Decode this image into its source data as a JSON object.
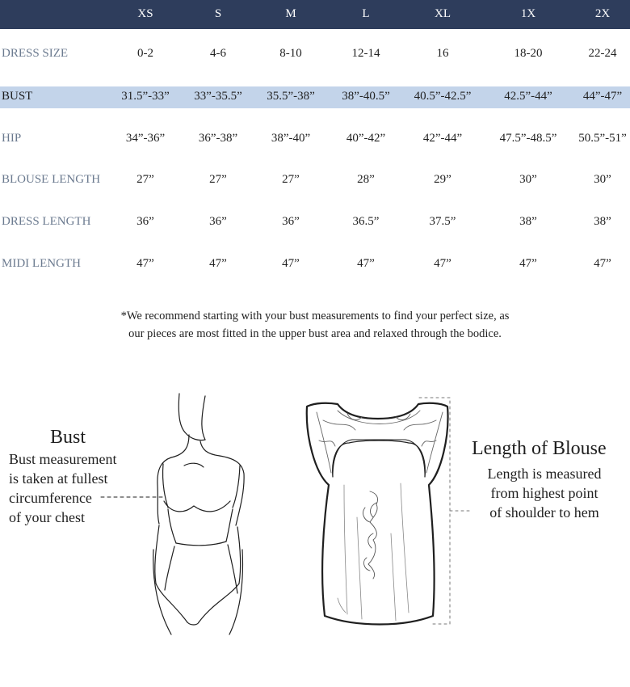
{
  "sizes": [
    "XS",
    "S",
    "M",
    "L",
    "XL",
    "1X",
    "2X"
  ],
  "rows": [
    {
      "label": "DRESS SIZE",
      "values": [
        "0-2",
        "4-6",
        "8-10",
        "12-14",
        "16",
        "18-20",
        "22-24"
      ]
    },
    {
      "label": "BUST",
      "values": [
        "31.5”-33”",
        "33”-35.5”",
        "35.5”-38”",
        "38”-40.5”",
        "40.5”-42.5”",
        "42.5”-44”",
        "44”-47”"
      ]
    },
    {
      "label": "HIP",
      "values": [
        "34”-36”",
        "36”-38”",
        "38”-40”",
        "40”-42”",
        "42”-44”",
        "47.5”-48.5”",
        "50.5”-51”"
      ]
    },
    {
      "label": "BLOUSE LENGTH",
      "values": [
        "27”",
        "27”",
        "27”",
        "28”",
        "29”",
        "30”",
        "30”"
      ]
    },
    {
      "label": "DRESS LENGTH",
      "values": [
        "36”",
        "36”",
        "36”",
        "36.5”",
        "37.5”",
        "38”",
        "38”"
      ]
    },
    {
      "label": "MIDI LENGTH",
      "values": [
        "47”",
        "47”",
        "47”",
        "47”",
        "47”",
        "47”",
        "47”"
      ]
    }
  ],
  "note": {
    "line1": "*We recommend starting with your bust measurements to find your perfect size, as",
    "line2": "our pieces are most fitted in the upper bust area and relaxed through the bodice."
  },
  "bust": {
    "title": "Bust",
    "lines": [
      "Bust measurement",
      "is taken at fullest",
      "circumference",
      "of your chest"
    ]
  },
  "blouse": {
    "title": "Length of Blouse",
    "lines": [
      "Length is measured",
      "from highest point",
      "of shoulder to hem"
    ]
  },
  "colors": {
    "header": "#2e3d5c",
    "highlight_row": "#c3d4ea",
    "label": "#6b7a8f"
  }
}
